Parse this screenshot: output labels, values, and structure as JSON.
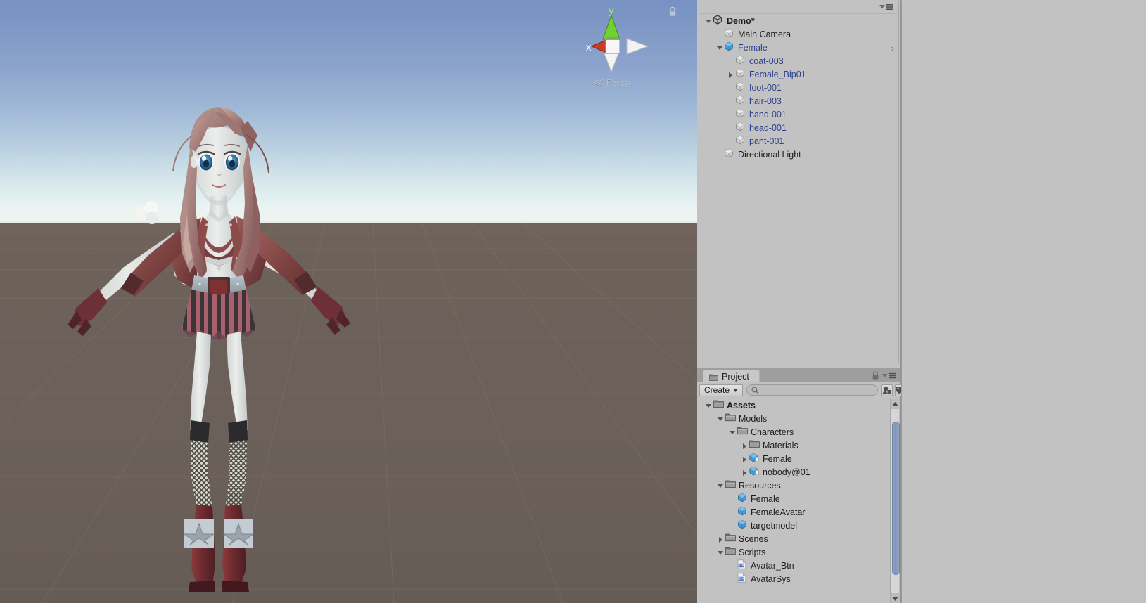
{
  "scene_view": {
    "gizmo": {
      "axis_x_label": "x",
      "axis_y_label": "y",
      "projection_label": "Persp",
      "lock_icon": "lock-icon"
    },
    "sky_top_color": "#7792c2",
    "sky_horizon_color": "#e9f3f2",
    "ground_color": "#6b605a",
    "character_name": "Female"
  },
  "hierarchy": {
    "menu_icon": "panel-menu-icon",
    "rows": [
      {
        "label": "Demo*",
        "indent": 0,
        "twisty": "down",
        "icon": "unity-scene-icon",
        "bold": true,
        "blue": false,
        "arrow": false
      },
      {
        "label": "Main Camera",
        "indent": 1,
        "twisty": "none",
        "icon": "gameobject-icon",
        "bold": false,
        "blue": false,
        "arrow": false
      },
      {
        "label": "Female",
        "indent": 1,
        "twisty": "down",
        "icon": "prefab-icon",
        "bold": false,
        "blue": true,
        "arrow": true
      },
      {
        "label": "coat-003",
        "indent": 2,
        "twisty": "none",
        "icon": "gameobject-icon",
        "bold": false,
        "blue": true,
        "arrow": false
      },
      {
        "label": "Female_Bip01",
        "indent": 2,
        "twisty": "right",
        "icon": "gameobject-icon",
        "bold": false,
        "blue": true,
        "arrow": false
      },
      {
        "label": "foot-001",
        "indent": 2,
        "twisty": "none",
        "icon": "gameobject-icon",
        "bold": false,
        "blue": true,
        "arrow": false
      },
      {
        "label": "hair-003",
        "indent": 2,
        "twisty": "none",
        "icon": "gameobject-icon",
        "bold": false,
        "blue": true,
        "arrow": false
      },
      {
        "label": "hand-001",
        "indent": 2,
        "twisty": "none",
        "icon": "gameobject-icon",
        "bold": false,
        "blue": true,
        "arrow": false
      },
      {
        "label": "head-001",
        "indent": 2,
        "twisty": "none",
        "icon": "gameobject-icon",
        "bold": false,
        "blue": true,
        "arrow": false
      },
      {
        "label": "pant-001",
        "indent": 2,
        "twisty": "none",
        "icon": "gameobject-icon",
        "bold": false,
        "blue": true,
        "arrow": false
      },
      {
        "label": "Directional Light",
        "indent": 1,
        "twisty": "none",
        "icon": "gameobject-icon",
        "bold": false,
        "blue": false,
        "arrow": false
      }
    ]
  },
  "project": {
    "tab_label": "Project",
    "tab_icon": "folder-icon",
    "lock_icon": "lock-icon",
    "menu_icon": "panel-menu-icon",
    "create_label": "Create",
    "create_dropdown_icon": "chevron-down-icon",
    "search_icon": "search-icon",
    "search_value": "",
    "search_placeholder": "",
    "filter_type_icon": "filter-by-type-icon",
    "filter_label_icon": "filter-by-label-icon",
    "rows": [
      {
        "label": "Assets",
        "indent": 0,
        "twisty": "down",
        "icon": "folder-icon",
        "bold": true
      },
      {
        "label": "Models",
        "indent": 1,
        "twisty": "down",
        "icon": "folder-icon",
        "bold": false
      },
      {
        "label": "Characters",
        "indent": 2,
        "twisty": "down",
        "icon": "folder-icon",
        "bold": false
      },
      {
        "label": "Materials",
        "indent": 3,
        "twisty": "right",
        "icon": "folder-icon",
        "bold": false
      },
      {
        "label": "Female",
        "indent": 3,
        "twisty": "right",
        "icon": "model-icon",
        "bold": false
      },
      {
        "label": "nobody@01",
        "indent": 3,
        "twisty": "right",
        "icon": "model-icon",
        "bold": false
      },
      {
        "label": "Resources",
        "indent": 1,
        "twisty": "down",
        "icon": "folder-icon",
        "bold": false
      },
      {
        "label": "Female",
        "indent": 2,
        "twisty": "none",
        "icon": "prefab-icon",
        "bold": false
      },
      {
        "label": "FemaleAvatar",
        "indent": 2,
        "twisty": "none",
        "icon": "prefab-icon",
        "bold": false
      },
      {
        "label": "targetmodel",
        "indent": 2,
        "twisty": "none",
        "icon": "prefab-icon",
        "bold": false
      },
      {
        "label": "Scenes",
        "indent": 1,
        "twisty": "right",
        "icon": "folder-icon",
        "bold": false
      },
      {
        "label": "Scripts",
        "indent": 1,
        "twisty": "down",
        "icon": "folder-icon",
        "bold": false
      },
      {
        "label": "Avatar_Btn",
        "indent": 2,
        "twisty": "none",
        "icon": "csharp-icon",
        "bold": false
      },
      {
        "label": "AvatarSys",
        "indent": 2,
        "twisty": "none",
        "icon": "csharp-icon",
        "bold": false
      }
    ],
    "scrollbar": {
      "up_arrow_icon": "triangle-up-icon",
      "down_arrow_icon": "triangle-down-icon",
      "thumb_color": "#7f96ba"
    }
  }
}
